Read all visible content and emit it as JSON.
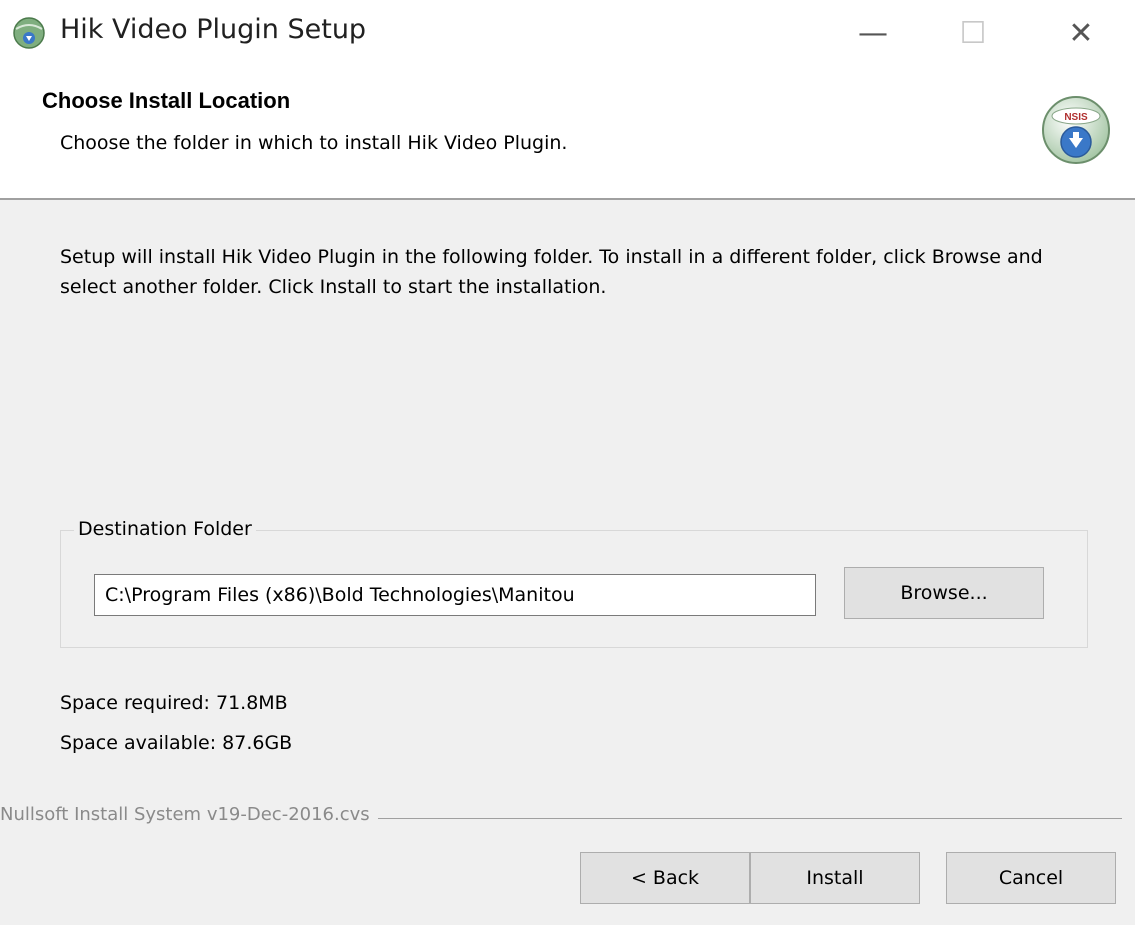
{
  "window": {
    "title": "Hik Video Plugin Setup",
    "minimize_glyph": "—",
    "maximize_glyph": "☐",
    "close_glyph": "✕"
  },
  "header": {
    "title": "Choose Install Location",
    "subtitle": "Choose the folder in which to install Hik Video Plugin.",
    "logo_text": "NSIS"
  },
  "content": {
    "description": "Setup will install Hik Video Plugin in the following folder. To install in a different folder, click Browse and select another folder. Click Install to start the installation.",
    "destination_group_label": "Destination Folder",
    "destination_path": "C:\\Program Files (x86)\\Bold Technologies\\Manitou",
    "browse_label": "Browse...",
    "space_required": "Space required: 71.8MB",
    "space_available": "Space available: 87.6GB"
  },
  "footer": {
    "branding": "Nullsoft Install System v19-Dec-2016.cvs",
    "back_label": "< Back",
    "install_label": "Install",
    "cancel_label": "Cancel"
  },
  "icons": {
    "app": "installer-globe-icon",
    "logo": "nsis-logo-icon"
  },
  "colors": {
    "dialog_bg": "#f0f0f0",
    "header_bg": "#ffffff",
    "button_bg": "#e1e1e1",
    "logo_green": "#6ca06c",
    "logo_blue": "#3a78c8"
  }
}
